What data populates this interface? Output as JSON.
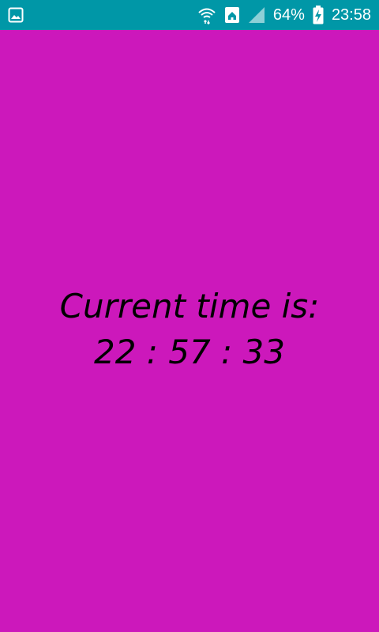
{
  "status_bar": {
    "left_icon": "gallery-notification-icon",
    "icons": [
      "wifi-icon",
      "home-launcher-icon",
      "signal-icon"
    ],
    "battery_percent": "64%",
    "battery_icon": "battery-charging-icon",
    "clock": "23:58",
    "background_color": "#0097a7"
  },
  "main": {
    "label": "Current time is:",
    "time": "22 : 57 : 33",
    "background_color": "#cc18bb",
    "text_color": "#000000"
  }
}
